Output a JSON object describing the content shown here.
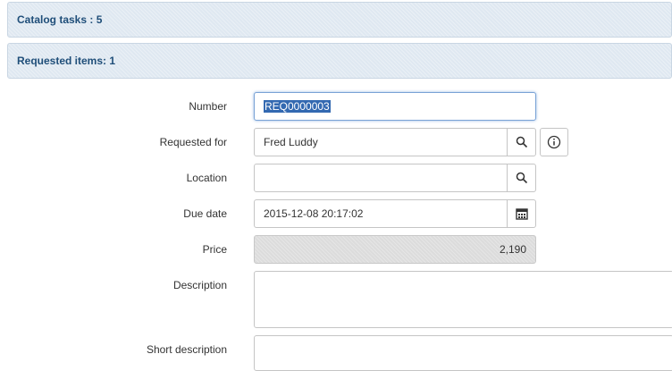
{
  "sections": {
    "catalog_tasks": "Catalog tasks : 5",
    "requested_items": "Requested items: 1"
  },
  "form": {
    "number": {
      "label": "Number",
      "value": "REQ0000003"
    },
    "requested_for": {
      "label": "Requested for",
      "value": "Fred Luddy"
    },
    "location": {
      "label": "Location",
      "value": ""
    },
    "due_date": {
      "label": "Due date",
      "value": "2015-12-08 20:17:02"
    },
    "price": {
      "label": "Price",
      "value": "2,190"
    },
    "description": {
      "label": "Description",
      "value": ""
    },
    "short_description": {
      "label": "Short description",
      "value": ""
    }
  },
  "icons": {
    "search": "search-icon",
    "info": "info-icon",
    "calendar": "calendar-icon"
  },
  "colors": {
    "section_bg": "#dfe8f1",
    "section_text": "#1f4e79",
    "selection": "#3369b1"
  }
}
